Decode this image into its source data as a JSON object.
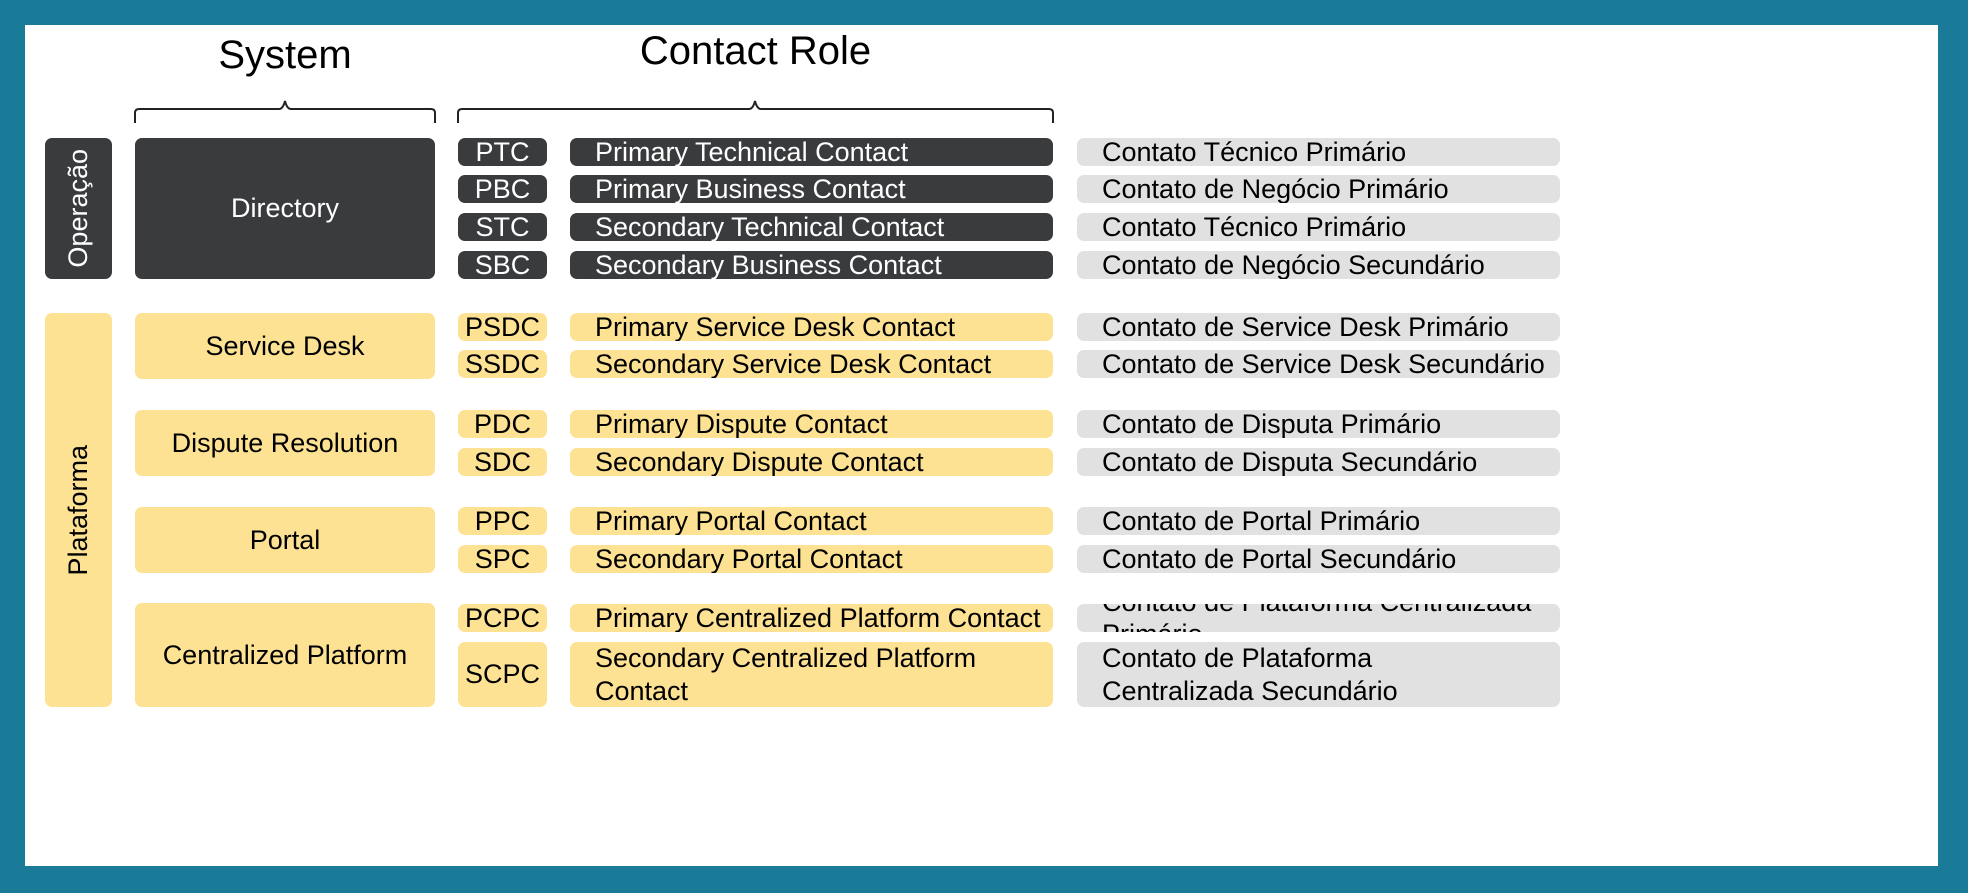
{
  "headers": {
    "system": "System",
    "contact_role": "Contact Role"
  },
  "colors": {
    "frame": "#1a7b98",
    "dark": "#3a3b3d",
    "yellow": "#fde294",
    "grey": "#e1e1e1"
  },
  "groups": [
    {
      "label": "Operação",
      "theme": "dark",
      "systems": [
        {
          "name": "Directory",
          "roles": [
            {
              "code": "PTC",
              "role": "Primary Technical Contact",
              "translation": "Contato Técnico Primário"
            },
            {
              "code": "PBC",
              "role": "Primary Business Contact",
              "translation": "Contato de Negócio Primário"
            },
            {
              "code": "STC",
              "role": "Secondary Technical Contact",
              "translation": "Contato Técnico Primário"
            },
            {
              "code": "SBC",
              "role": "Secondary Business Contact",
              "translation": "Contato de Negócio Secundário"
            }
          ]
        }
      ]
    },
    {
      "label": "Plataforma",
      "theme": "yellow",
      "systems": [
        {
          "name": "Service Desk",
          "roles": [
            {
              "code": "PSDC",
              "role": "Primary Service Desk Contact",
              "translation": "Contato de Service Desk Primário"
            },
            {
              "code": "SSDC",
              "role": "Secondary Service Desk Contact",
              "translation": "Contato de Service Desk Secundário"
            }
          ]
        },
        {
          "name": "Dispute Resolution",
          "roles": [
            {
              "code": "PDC",
              "role": "Primary Dispute Contact",
              "translation": "Contato de Disputa Primário"
            },
            {
              "code": "SDC",
              "role": "Secondary Dispute Contact",
              "translation": "Contato de Disputa Secundário"
            }
          ]
        },
        {
          "name": "Portal",
          "roles": [
            {
              "code": "PPC",
              "role": "Primary Portal Contact",
              "translation": "Contato de Portal Primário"
            },
            {
              "code": "SPC",
              "role": "Secondary Portal Contact",
              "translation": "Contato de Portal Secundário"
            }
          ]
        },
        {
          "name": "Centralized Platform",
          "roles": [
            {
              "code": "PCPC",
              "role": "Primary Centralized Platform Contact",
              "translation": "Contato de Plataforma Centralizada Primário"
            },
            {
              "code": "SCPC",
              "role": "Secondary Centralized Platform Contact",
              "translation": "Contato de Plataforma Centralizada Secundário"
            }
          ]
        }
      ]
    }
  ]
}
